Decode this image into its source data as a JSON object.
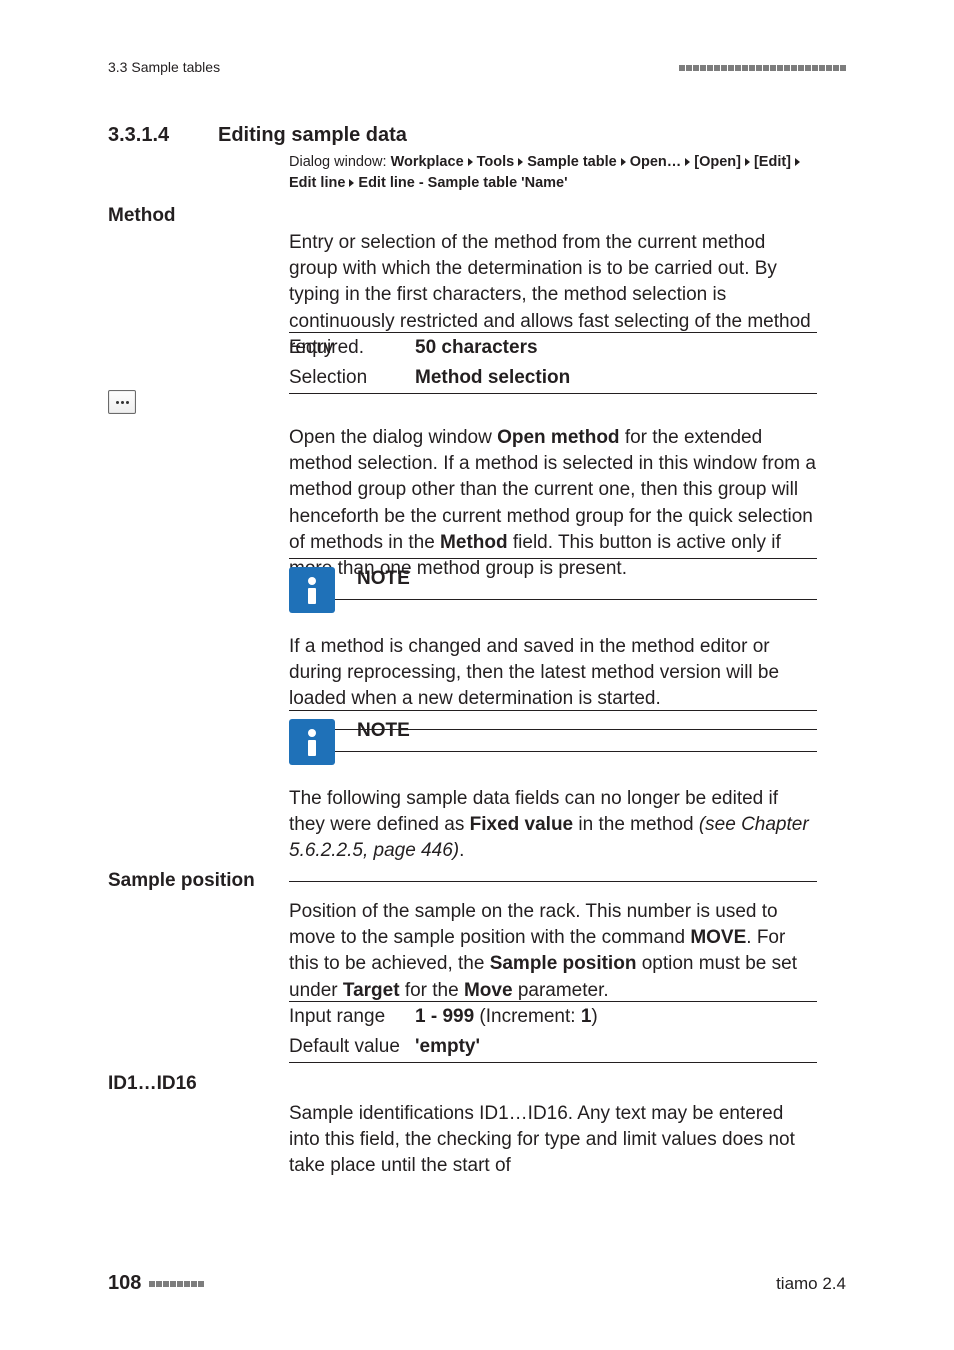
{
  "header": {
    "section_path": "3.3 Sample tables"
  },
  "heading": {
    "number": "3.3.1.4",
    "title": "Editing sample data"
  },
  "dialog": {
    "prefix": "Dialog window:",
    "p1": "Workplace",
    "p2": "Tools",
    "p3": "Sample table",
    "p4": "Open…",
    "p5": "[Open]",
    "p6": "[Edit]",
    "p7": "Edit line",
    "p8": "Edit line - Sample table 'Name'"
  },
  "method": {
    "label": "Method",
    "desc": "Entry or selection of the method from the current method group with which the determination is to be carried out. By typing in the first characters, the method selection is continuously restricted and allows fast selecting of the method required.",
    "entry_label": "Entry",
    "entry_value": "50 characters",
    "selection_label": "Selection",
    "selection_value": "Method selection"
  },
  "open_method": {
    "p_before": "Open the dialog window ",
    "bold": "Open method",
    "p_mid": " for the extended method selection. If a method is selected in this window from a method group other than the current one, then this group will henceforth be the current method group for the quick selection of methods in the ",
    "bold2": "Method",
    "p_after": " field. This button is active only if more than one method group is present."
  },
  "note1": {
    "title": "NOTE",
    "body": "If a method is changed and saved in the method editor or during reprocessing, then the latest method version will be loaded when a new determination is started."
  },
  "note2": {
    "title": "NOTE",
    "body_a": "The following sample data fields can no longer be edited if they were defined as ",
    "body_b": "Fixed value",
    "body_c": " in the method ",
    "body_d": "(see Chapter 5.6.2.2.5, page 446)",
    "body_e": "."
  },
  "sample_position": {
    "label": "Sample position",
    "desc_a": "Position of the sample on the rack. This number is used to move to the sample position with the command ",
    "desc_b": "MOVE",
    "desc_c": ". For this to be achieved, the ",
    "desc_d": "Sample position",
    "desc_e": " option must be set under ",
    "desc_f": "Target",
    "desc_g": " for the ",
    "desc_h": "Move",
    "desc_i": " parameter.",
    "range_label": "Input range",
    "range_a": "1 - 999",
    "range_b": "  (Increment: ",
    "range_c": "1",
    "range_d": ")",
    "default_label": "Default value",
    "default_value": "'empty'"
  },
  "id": {
    "label": "ID1…ID16",
    "desc": "Sample identifications ID1…ID16. Any text may be entered into this field, the checking for type and limit values does not take place until the start of"
  },
  "footer": {
    "page": "108",
    "product": "tiamo 2.4"
  }
}
